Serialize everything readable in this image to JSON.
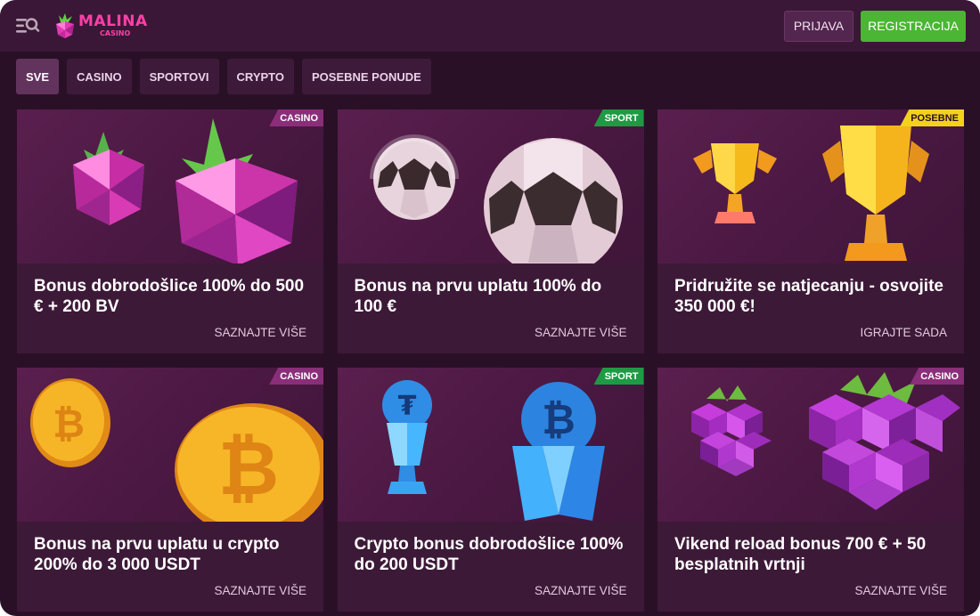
{
  "header": {
    "logo_main": "MALINA",
    "logo_sub": "CASINO",
    "login_label": "PRIJAVA",
    "register_label": "REGISTRACIJA"
  },
  "tabs": [
    {
      "label": "SVE",
      "active": true
    },
    {
      "label": "CASINO",
      "active": false
    },
    {
      "label": "SPORTOVI",
      "active": false
    },
    {
      "label": "CRYPTO",
      "active": false
    },
    {
      "label": "POSEBNE PONUDE",
      "active": false
    }
  ],
  "cards": [
    {
      "badge": "CASINO",
      "title": "Bonus dobrodošlice 100% do 500 € + 200 BV",
      "cta": "SAZNAJTE VIŠE",
      "image": "raspberries"
    },
    {
      "badge": "SPORT",
      "title": "Bonus na prvu uplatu 100% do 100 €",
      "cta": "SAZNAJTE VIŠE",
      "image": "soccer-balls"
    },
    {
      "badge": "POSEBNE",
      "title": "Pridružite se natjecanju - osvojite 350 000 €!",
      "cta": "IGRAJTE SADA",
      "image": "trophies"
    },
    {
      "badge": "CASINO",
      "title": "Bonus na prvu uplatu u crypto 200% do 3 000 USDT",
      "cta": "SAZNAJTE VIŠE",
      "image": "bitcoin-coins"
    },
    {
      "badge": "SPORT",
      "title": "Crypto bonus dobrodošlice 100% do 200 USDT",
      "cta": "SAZNAJTE VIŠE",
      "image": "crypto-trophies"
    },
    {
      "badge": "CASINO",
      "title": "Vikend reload bonus 700 € + 50 besplatnih vrtnji",
      "cta": "SAZNAJTE VIŠE",
      "image": "grapes"
    }
  ],
  "colors": {
    "background": "#2a1027",
    "header": "#3a1736",
    "card": "#3d1938",
    "brand_pink": "#ff3fa7",
    "register_green": "#4bb534",
    "badge_casino": "#8b2e7a",
    "badge_sport": "#1f9a44",
    "badge_posebne": "#f4d21c"
  },
  "icons": {
    "menu": "menu-search-icon",
    "logo": "raspberry-logo-icon"
  }
}
